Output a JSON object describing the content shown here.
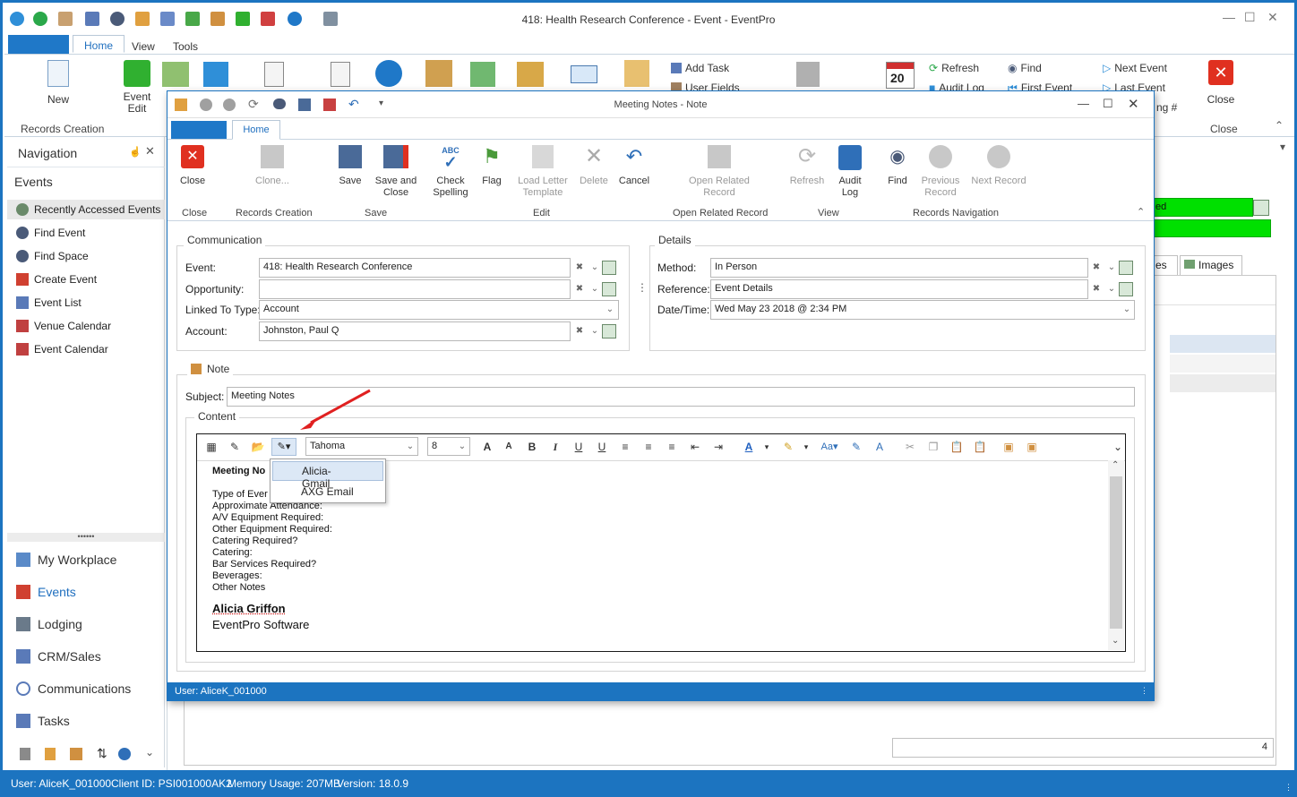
{
  "app": {
    "title": "418: Health Research Conference - Event - EventPro",
    "tabs": [
      "Home",
      "View",
      "Tools"
    ]
  },
  "ribbon": {
    "new_label": "New",
    "event_edit_label": "Event Edit",
    "records_creation": "Records Creation",
    "add_task": "Add Task",
    "user_fields": "User Fields",
    "refresh": "Refresh",
    "audit_log": "Audit Log",
    "find": "Find",
    "first_event": "First Event",
    "next_event": "Next Event",
    "last_event": "Last Event",
    "close": "Close",
    "close_group": "Close",
    "calendar_day": "20",
    "record_num": "ng #"
  },
  "nav": {
    "title": "Navigation",
    "section": "Events",
    "items": [
      "Recently Accessed Events",
      "Find Event",
      "Find Space",
      "Create Event",
      "Event List",
      "Venue Calendar",
      "Event Calendar"
    ],
    "modules": [
      "My Workplace",
      "Events",
      "Lodging",
      "CRM/Sales",
      "Communications",
      "Tasks"
    ]
  },
  "right_panel": {
    "status_suffix": "ed",
    "tab_partial": "es",
    "tab_images": "Images",
    "footer_value": "4"
  },
  "status": {
    "user": "User: AliceK_001000",
    "client": "Client ID: PSI001000AK2",
    "memory": "Memory Usage: 207MB",
    "version": "Version: 18.0.9"
  },
  "dialog": {
    "title": "Meeting Notes - Note",
    "tab": "Home",
    "buttons": {
      "close": "Close",
      "clone": "Clone...",
      "save": "Save",
      "save_close": "Save and Close",
      "check": "Check Spelling",
      "flag": "Flag",
      "load": "Load Letter Template",
      "delete": "Delete",
      "cancel": "Cancel",
      "open_related": "Open Related Record",
      "refresh": "Refresh",
      "audit": "Audit Log",
      "find": "Find",
      "prev": "Previous Record",
      "next": "Next Record"
    },
    "groups": [
      "Close",
      "Records Creation",
      "Save",
      "Edit",
      "Open Related Record",
      "View",
      "Records Navigation"
    ],
    "communication": {
      "title": "Communication",
      "event_label": "Event:",
      "event_value": "418: Health Research Conference",
      "opp_label": "Opportunity:",
      "opp_value": "",
      "linked_label": "Linked To Type:",
      "linked_value": "Account",
      "account_label": "Account:",
      "account_value": "Johnston, Paul Q"
    },
    "details": {
      "title": "Details",
      "method_label": "Method:",
      "method_value": "In Person",
      "ref_label": "Reference:",
      "ref_value": "Event Details",
      "date_label": "Date/Time:",
      "date_value": "Wed May 23 2018 @ 2:34 PM"
    },
    "note": {
      "title": "Note",
      "subject_label": "Subject:",
      "subject_value": "Meeting Notes",
      "content_label": "Content"
    },
    "editor": {
      "font": "Tahoma",
      "size": "8",
      "heading": "Meeting No",
      "lines": [
        "Type of Ever",
        "Approximate Attendance:",
        "A/V Equipment Required:",
        "Other Equipment Required:",
        "Catering Required?",
        "Catering:",
        "Bar Services Required?",
        "Beverages:",
        "Other Notes"
      ],
      "sig_name": "Alicia Griffon",
      "sig_company": "EventPro Software",
      "dropdown": [
        "Alicia-Gmail",
        "AXG Email"
      ]
    },
    "status_user": "User: AliceK_001000"
  },
  "colors": {
    "accent": "#1c74c0",
    "status_green": "#00e000",
    "close_red": "#e03020"
  }
}
